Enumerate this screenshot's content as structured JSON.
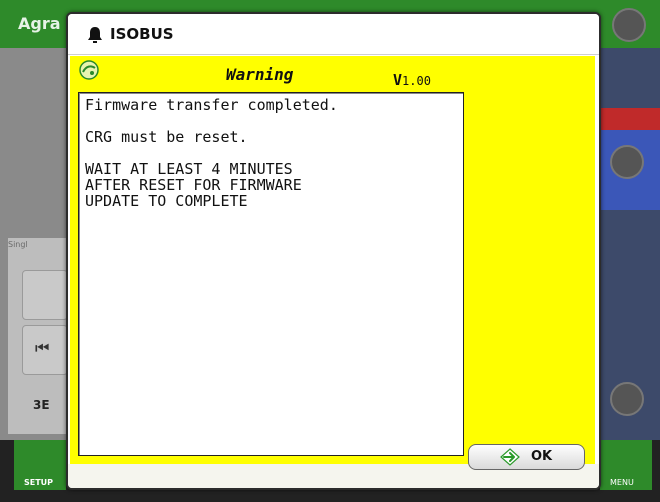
{
  "background": {
    "app_title": "Agra",
    "left_panel_label": "Singl",
    "left_code": "3E",
    "setup_label": "SETUP",
    "menu_label": "MENU"
  },
  "dialog": {
    "title": "ISOBUS",
    "heading": "Warning",
    "version_letter": "V",
    "version_number": "1.00",
    "message": [
      "Firmware transfer completed.",
      "",
      "CRG must be reset.",
      "",
      "WAIT AT LEAST 4 MINUTES",
      "AFTER RESET FOR FIRMWARE",
      "UPDATE TO COMPLETE"
    ],
    "ok_label": "OK"
  },
  "colors": {
    "mask_background": "#ffff00",
    "app_green": "#2e8a2a",
    "ok_arrow": "#2a9a2a"
  },
  "icons": {
    "dialog_icon": "bell-icon",
    "mask_logo": "implement-logo-icon",
    "ok_icon": "arrow-right-icon"
  }
}
